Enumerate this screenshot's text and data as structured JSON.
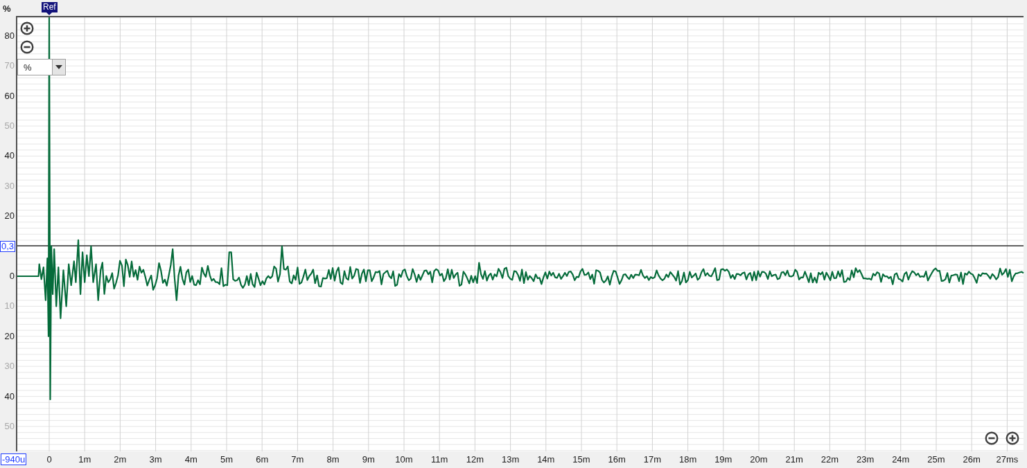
{
  "y_axis": {
    "unit": "%",
    "labels": [
      {
        "text": "80",
        "kind": "major"
      },
      {
        "text": "70",
        "kind": "minor"
      },
      {
        "text": "60",
        "kind": "major"
      },
      {
        "text": "50",
        "kind": "minor"
      },
      {
        "text": "40",
        "kind": "major"
      },
      {
        "text": "30",
        "kind": "minor"
      },
      {
        "text": "20",
        "kind": "major"
      },
      {
        "text": "0,3",
        "kind": "cursor"
      },
      {
        "text": "0",
        "kind": "major"
      },
      {
        "text": "10",
        "kind": "minor"
      },
      {
        "text": "20",
        "kind": "major"
      },
      {
        "text": "30",
        "kind": "minor"
      },
      {
        "text": "40",
        "kind": "major"
      },
      {
        "text": "50",
        "kind": "minor"
      }
    ]
  },
  "x_axis": {
    "labels": [
      {
        "text": "-940u",
        "kind": "cursor"
      },
      {
        "text": "0",
        "kind": "major"
      },
      {
        "text": "1m",
        "kind": "major"
      },
      {
        "text": "2m",
        "kind": "major"
      },
      {
        "text": "3m",
        "kind": "major"
      },
      {
        "text": "4m",
        "kind": "major"
      },
      {
        "text": "5m",
        "kind": "major"
      },
      {
        "text": "6m",
        "kind": "major"
      },
      {
        "text": "7m",
        "kind": "major"
      },
      {
        "text": "8m",
        "kind": "major"
      },
      {
        "text": "9m",
        "kind": "major"
      },
      {
        "text": "10m",
        "kind": "major"
      },
      {
        "text": "11m",
        "kind": "major"
      },
      {
        "text": "12m",
        "kind": "major"
      },
      {
        "text": "13m",
        "kind": "major"
      },
      {
        "text": "14m",
        "kind": "major"
      },
      {
        "text": "15m",
        "kind": "major"
      },
      {
        "text": "16m",
        "kind": "major"
      },
      {
        "text": "17m",
        "kind": "major"
      },
      {
        "text": "18m",
        "kind": "major"
      },
      {
        "text": "19m",
        "kind": "major"
      },
      {
        "text": "20m",
        "kind": "major"
      },
      {
        "text": "21m",
        "kind": "major"
      },
      {
        "text": "22m",
        "kind": "major"
      },
      {
        "text": "23m",
        "kind": "major"
      },
      {
        "text": "24m",
        "kind": "major"
      },
      {
        "text": "25m",
        "kind": "major"
      },
      {
        "text": "26m",
        "kind": "major"
      },
      {
        "text": "27ms",
        "kind": "major"
      }
    ]
  },
  "ref_marker": {
    "label": "Ref"
  },
  "unit_dropdown": {
    "value": "%"
  }
}
